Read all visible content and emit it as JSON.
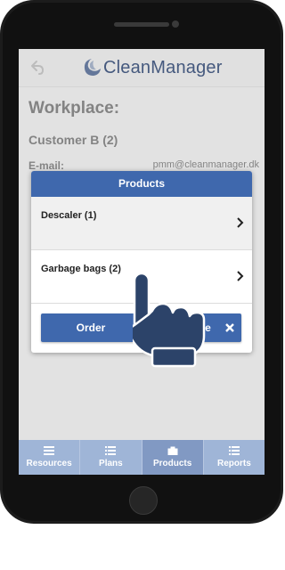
{
  "app": {
    "name": "CleanManager"
  },
  "page": {
    "heading": "Workplace:",
    "customer": "Customer B (2)",
    "email_label": "E-mail:",
    "email_value": "pmm@cleanmanager.dk"
  },
  "modal": {
    "title": "Products",
    "items": [
      {
        "label": "Descaler (1)"
      },
      {
        "label": "Garbage bags (2)"
      }
    ],
    "order_label": "Order",
    "close_label": "Close"
  },
  "tabs": [
    {
      "label": "Resources",
      "icon": "list-icon"
    },
    {
      "label": "Plans",
      "icon": "list-icon"
    },
    {
      "label": "Products",
      "icon": "bag-icon",
      "active": true
    },
    {
      "label": "Reports",
      "icon": "list-icon"
    }
  ],
  "colors": {
    "primary": "#3f68ad",
    "tabbar": "#9fb5d7",
    "tabbar_active": "#8199c3",
    "hand": "#2c4369"
  }
}
